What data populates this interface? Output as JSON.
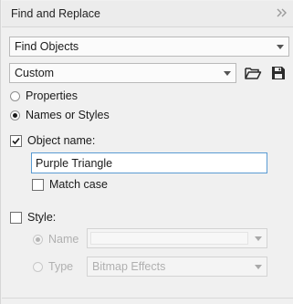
{
  "panel": {
    "title": "Find and Replace",
    "expand_icon": "double-chevron-right-icon"
  },
  "find_mode": {
    "selected": "Find Objects"
  },
  "preset": {
    "selected": "Custom",
    "open_icon": "folder-open-icon",
    "save_icon": "save-disk-icon"
  },
  "search_by": {
    "properties_label": "Properties",
    "names_styles_label": "Names or Styles",
    "selected": "Names or Styles"
  },
  "object_name": {
    "label": "Object name:",
    "checked": true,
    "value": "Purple Triangle",
    "match_case_label": "Match case",
    "match_case_checked": false
  },
  "style": {
    "label": "Style:",
    "checked": false,
    "name_label": "Name",
    "type_label": "Type",
    "selected_option": "Name",
    "name_value": "",
    "type_value": "Bitmap Effects"
  }
}
